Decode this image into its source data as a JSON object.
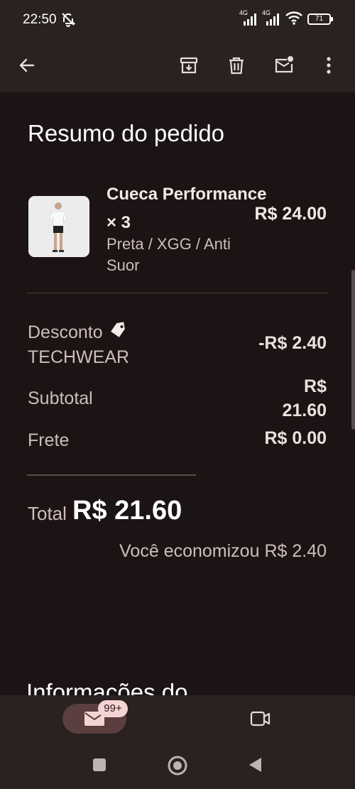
{
  "status_bar": {
    "time": "22:50",
    "sim1_label": "4G",
    "sim2_label": "4G",
    "battery": "71",
    "bell_icon": "bell-off-icon",
    "wifi_icon": "wifi-icon"
  },
  "app_bar": {
    "back_icon": "arrow-back-icon",
    "archive_icon": "archive-icon",
    "delete_icon": "trash-icon",
    "unread_icon": "mark-unread-icon",
    "more_icon": "more-vert-icon"
  },
  "email": {
    "section_title": "Resumo do pedido",
    "product": {
      "name": "Cueca Performance × 3",
      "variant": "Preta / XGG / Anti Suor",
      "price": "R$ 24.00",
      "image_icon": "product-photo"
    },
    "discount_label": "Desconto",
    "discount_code": "TECHWEAR",
    "discount_value": "-R$ 2.40",
    "subtotal_label": "Subtotal",
    "subtotal_value": "R$ 21.60",
    "shipping_label": "Frete",
    "shipping_value": "R$ 0.00",
    "total_label": "Total",
    "total_value": "R$ 21.60",
    "savings_text": "Você economizou R$ 2.40",
    "next_section_title": "Informações do"
  },
  "bottom_nav": {
    "mail_badge": "99+",
    "mail_icon": "mail-icon",
    "video_icon": "videocam-icon"
  },
  "colors": {
    "background": "#1c1414",
    "bar": "#2a2121",
    "pill": "#5a3f3e",
    "badge": "#f5d4d4"
  }
}
